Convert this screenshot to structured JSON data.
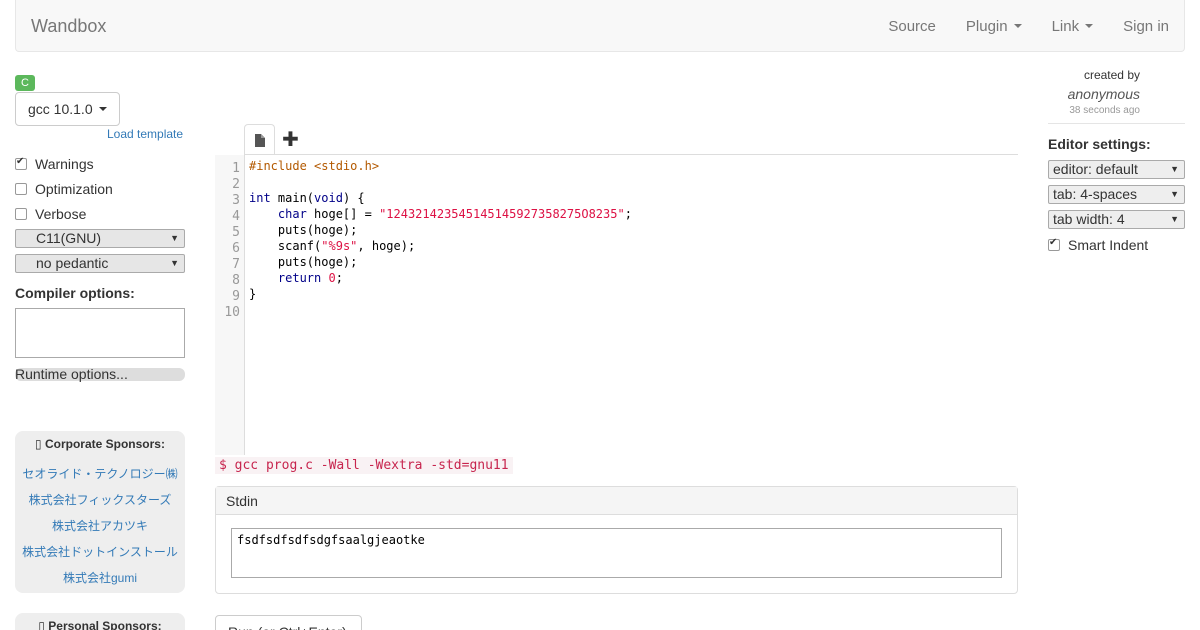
{
  "navbar": {
    "brand": "Wandbox",
    "items": [
      {
        "label": "Source",
        "dropdown": false
      },
      {
        "label": "Plugin",
        "dropdown": true
      },
      {
        "label": "Link",
        "dropdown": true
      },
      {
        "label": "Sign in",
        "dropdown": false
      }
    ]
  },
  "left": {
    "language_badge": "C",
    "compiler": "gcc 10.1.0",
    "load_template": "Load template",
    "options": [
      {
        "label": "Warnings",
        "checked": true
      },
      {
        "label": "Optimization",
        "checked": false
      },
      {
        "label": "Verbose",
        "checked": false
      }
    ],
    "std_select": "C11(GNU)",
    "pedantic_select": "no pedantic",
    "compiler_options_label": "Compiler options:",
    "runtime_options": "Runtime options...",
    "corporate_sponsors_title": "Corporate Sponsors:",
    "corporate_sponsors": [
      "セオライド・テクノロジー㈱",
      "株式会社フィックスターズ",
      "株式会社アカツキ",
      "株式会社ドットインストール",
      "株式会社gumi"
    ],
    "personal_sponsors_title": "Personal Sponsors:"
  },
  "editor": {
    "line_numbers": [
      "1",
      "2",
      "3",
      "4",
      "5",
      "6",
      "7",
      "8",
      "9",
      "10"
    ],
    "code_line1": "#include <stdio.h>",
    "kw_int": "int",
    "main_sig": " main(",
    "kw_void": "void",
    "main_end": ") {",
    "kw_char": "char",
    "decl": " hoge[] = ",
    "str_literal": "\"124321423545145145927358275O8235\"",
    "semi": ";",
    "puts1": "puts(hoge);",
    "scanf_start": "scanf(",
    "scanf_fmt": "\"%9s\"",
    "scanf_end": ", hoge);",
    "puts2": "puts(hoge);",
    "kw_return": "return",
    "ret_val": "0",
    "close_brace": "}"
  },
  "command_line": "$ gcc prog.c -Wall -Wextra -std=gnu11",
  "stdin": {
    "title": "Stdin",
    "value": "fsdfsdfsdfsdgfsaalgjeaotke"
  },
  "run_button": "Run (or Ctrl+Enter)",
  "right": {
    "created_by": "created by",
    "author": "anonymous",
    "time": "38 seconds ago",
    "editor_settings_label": "Editor settings:",
    "editor_select": "editor: default",
    "tab_select": "tab: 4-spaces",
    "tab_width_select": "tab width: 4",
    "smart_indent": "Smart Indent",
    "smart_indent_checked": true
  },
  "icons": {
    "file_tab": "file-icon",
    "add_tab": "plus-icon"
  }
}
